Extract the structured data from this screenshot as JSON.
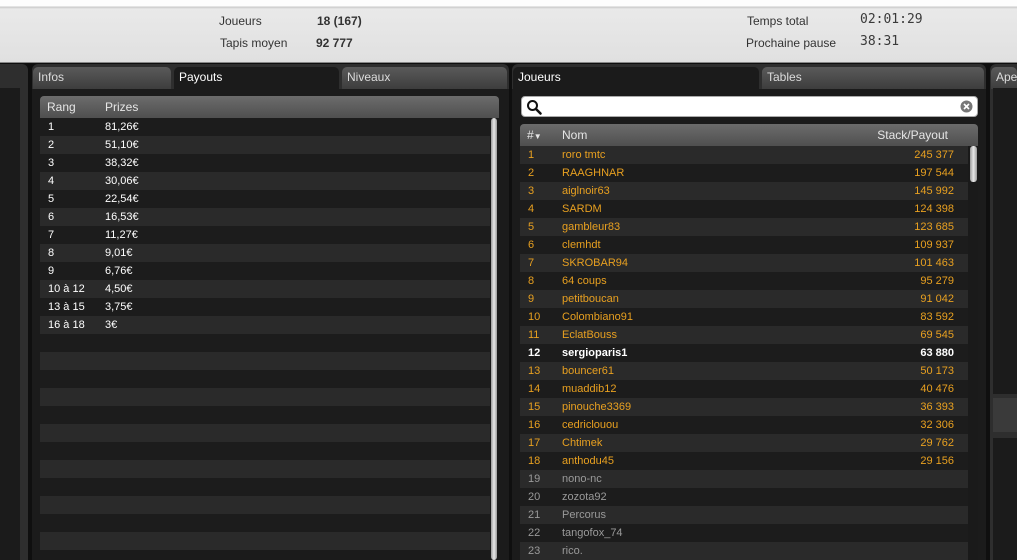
{
  "stats": {
    "players_label": "Joueurs",
    "players_value": "18 (167)",
    "avg_stack_label": "Tapis moyen",
    "avg_stack_value": "92 777",
    "total_time_label": "Temps total",
    "total_time_value": "02:01:29",
    "next_break_label": "Prochaine pause",
    "next_break_value": "38:31"
  },
  "left_tabs": {
    "infos": "Infos",
    "payouts": "Payouts",
    "niveaux": "Niveaux"
  },
  "payouts": {
    "col_rank": "Rang",
    "col_prizes": "Prizes",
    "rows": [
      {
        "rank": "1",
        "prize": "81,26€"
      },
      {
        "rank": "2",
        "prize": "51,10€"
      },
      {
        "rank": "3",
        "prize": "38,32€"
      },
      {
        "rank": "4",
        "prize": "30,06€"
      },
      {
        "rank": "5",
        "prize": "22,54€"
      },
      {
        "rank": "6",
        "prize": "16,53€"
      },
      {
        "rank": "7",
        "prize": "11,27€"
      },
      {
        "rank": "8",
        "prize": "9,01€"
      },
      {
        "rank": "9",
        "prize": "6,76€"
      },
      {
        "rank": "10 à 12",
        "prize": "4,50€"
      },
      {
        "rank": "13 à 15",
        "prize": "3,75€"
      },
      {
        "rank": "16 à 18",
        "prize": "3€"
      }
    ]
  },
  "right_tabs": {
    "joueurs": "Joueurs",
    "tables": "Tables",
    "ape": "Ape"
  },
  "players": {
    "col_num": "#",
    "col_name": "Nom",
    "col_stack": "Stack/Payout",
    "rows": [
      {
        "num": "1",
        "name": "roro tmtc",
        "stack": "245 377",
        "status": "active"
      },
      {
        "num": "2",
        "name": "RAAGHNAR",
        "stack": "197 544",
        "status": "active"
      },
      {
        "num": "3",
        "name": "aiglnoir63",
        "stack": "145 992",
        "status": "active"
      },
      {
        "num": "4",
        "name": "SARDM",
        "stack": "124 398",
        "status": "active"
      },
      {
        "num": "5",
        "name": "gambleur83",
        "stack": "123 685",
        "status": "active"
      },
      {
        "num": "6",
        "name": "clemhdt",
        "stack": "109 937",
        "status": "active"
      },
      {
        "num": "7",
        "name": "SKROBAR94",
        "stack": "101 463",
        "status": "active"
      },
      {
        "num": "8",
        "name": "64 coups",
        "stack": "95 279",
        "status": "active"
      },
      {
        "num": "9",
        "name": "petitboucan",
        "stack": "91 042",
        "status": "active"
      },
      {
        "num": "10",
        "name": "Colombiano91",
        "stack": "83 592",
        "status": "active"
      },
      {
        "num": "11",
        "name": "EclatBouss",
        "stack": "69 545",
        "status": "active"
      },
      {
        "num": "12",
        "name": "sergioparis1",
        "stack": "63 880",
        "status": "self"
      },
      {
        "num": "13",
        "name": "bouncer61",
        "stack": "50 173",
        "status": "active"
      },
      {
        "num": "14",
        "name": "muaddib12",
        "stack": "40 476",
        "status": "active"
      },
      {
        "num": "15",
        "name": "pinouche3369",
        "stack": "36 393",
        "status": "active"
      },
      {
        "num": "16",
        "name": "cedriclouou",
        "stack": "32 306",
        "status": "active"
      },
      {
        "num": "17",
        "name": "Chtimek",
        "stack": "29 762",
        "status": "active"
      },
      {
        "num": "18",
        "name": "anthodu45",
        "stack": "29 156",
        "status": "active"
      },
      {
        "num": "19",
        "name": "nono-nc",
        "stack": "",
        "status": "out"
      },
      {
        "num": "20",
        "name": "zozota92",
        "stack": "",
        "status": "out"
      },
      {
        "num": "21",
        "name": "Percorus",
        "stack": "",
        "status": "out"
      },
      {
        "num": "22",
        "name": "tangofox_74",
        "stack": "",
        "status": "out"
      },
      {
        "num": "23",
        "name": "rico.",
        "stack": "",
        "status": "out"
      }
    ]
  },
  "colors": {
    "active": "#e8a020",
    "self": "#ffffff",
    "out": "#9a9a9a",
    "row_dark": "#1c1c1c",
    "row_light": "#2a2a2a"
  }
}
